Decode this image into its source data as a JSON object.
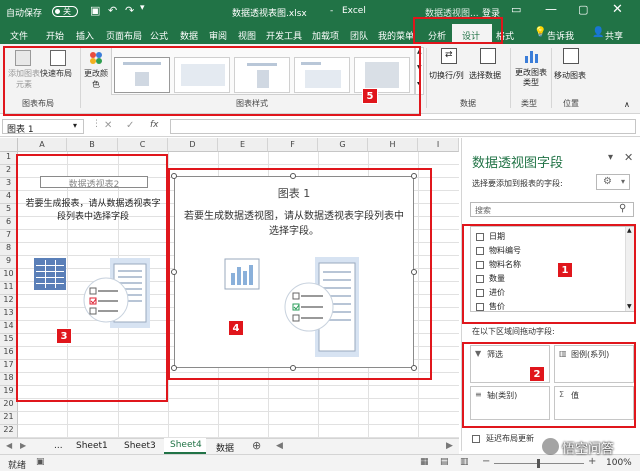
{
  "titlebar": {
    "autosave_label": "自动保存",
    "autosave_state": "关",
    "filename": "数据透视表图.xlsx",
    "separator": "-",
    "app_name": "Excel",
    "context_label": "数据透视图...",
    "login_label": "登录"
  },
  "menu_tabs": [
    "文件",
    "开始",
    "插入",
    "页面布局",
    "公式",
    "数据",
    "审阅",
    "视图",
    "开发工具",
    "加载项",
    "团队",
    "我的菜单"
  ],
  "context_tabs": {
    "analyze": "分析",
    "design": "设计",
    "format": "格式"
  },
  "tell_me": "告诉我",
  "share": "共享",
  "ribbon": {
    "add_element": "添加图表元素",
    "quick_layout": "快速布局",
    "change_colors": "更改颜色",
    "group_layouts": "图表布局",
    "group_styles": "图表样式",
    "switch_rowcol": "切换行/列",
    "select_data": "选择数据",
    "group_data": "数据",
    "change_type": "更改图表类型",
    "group_type": "类型",
    "move_chart": "移动图表",
    "group_location": "位置"
  },
  "formula_bar": {
    "name_box": "图表 1",
    "fx": "fx"
  },
  "columns": [
    "A",
    "B",
    "C",
    "D",
    "E",
    "F",
    "G",
    "H",
    "I"
  ],
  "rows": [
    "1",
    "2",
    "3",
    "4",
    "5",
    "6",
    "7",
    "8",
    "9",
    "10",
    "11",
    "12",
    "13",
    "14",
    "15",
    "16",
    "17",
    "18",
    "19",
    "20",
    "21",
    "22"
  ],
  "pivot_table": {
    "title": "数据透视表2",
    "message": "若要生成报表，请从数据透视表字段列表中选择字段"
  },
  "pivot_chart": {
    "title": "图表 1",
    "message": "若要生成数据透视图，请从数据透视表字段列表中选择字段。"
  },
  "panel": {
    "title": "数据透视图字段",
    "subtitle": "选择要添加到报表的字段:",
    "search_placeholder": "搜索",
    "fields": [
      "日期",
      "物料编号",
      "物料名称",
      "数量",
      "进价",
      "售价"
    ],
    "drag_label": "在以下区域间拖动字段:",
    "area_filter": "筛选",
    "area_legend": "图例(系列)",
    "area_axis": "轴(类别)",
    "area_values": "值",
    "defer_update": "延迟布局更新"
  },
  "sheet_tabs": [
    "...",
    "Sheet1",
    "Sheet3",
    "Sheet4",
    "数据"
  ],
  "active_sheet": "Sheet4",
  "status": {
    "ready": "就绪",
    "zoom": "100%"
  },
  "watermark": "悟空问答",
  "badges": [
    "1",
    "2",
    "3",
    "4",
    "5"
  ],
  "colors": {
    "excel_green": "#217346",
    "highlight_red": "#e0161c"
  }
}
